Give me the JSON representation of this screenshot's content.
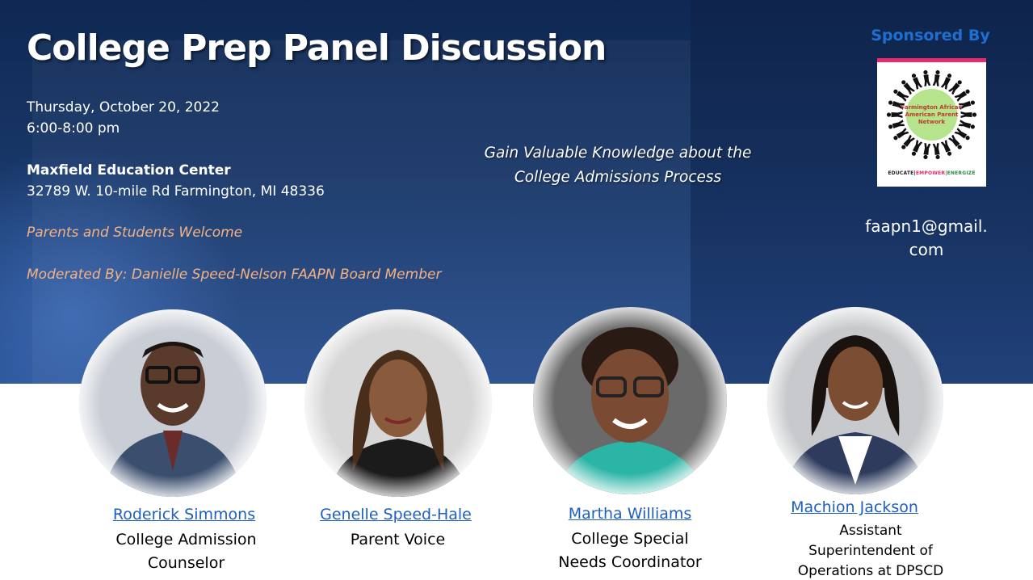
{
  "event": {
    "title": "College Prep Panel Discussion",
    "date": "Thursday, October 20, 2022",
    "time": "6:00-8:00 pm",
    "venue": "Maxfield Education Center",
    "address": "32789 W.  10-mile Rd Farmington, MI 48336",
    "welcome": "Parents and Students Welcome",
    "moderator": "Moderated By:  Danielle Speed-Nelson FAAPN Board Member",
    "tagline_line1": "Gain Valuable Knowledge about the",
    "tagline_line2": "College Admissions Process"
  },
  "sponsor": {
    "label": "Sponsored By",
    "logo_text": "Farmington African American Parent Network",
    "logo_tagline_1": "EDUCATE|",
    "logo_tagline_2": "EMPOWER",
    "logo_tagline_3": "|ENERGIZE",
    "email_line1": "faapn1@gmail.",
    "email_line2": "com"
  },
  "panelists": [
    {
      "name": "Roderick Simmons",
      "role_line1": "College Admission",
      "role_line2": "Counselor"
    },
    {
      "name": "Genelle Speed-Hale",
      "role_line1": "Parent Voice"
    },
    {
      "name": "Martha Williams",
      "role_line1": "College Special",
      "role_line2": "Needs Coordinator"
    },
    {
      "name": "Machion Jackson",
      "role_line1": "Assistant",
      "role_line2": "Superintendent of",
      "role_line3": "Operations at  DPSCD"
    }
  ],
  "colors": {
    "banner_dark": "#0f2853",
    "banner_light": "#284f8f",
    "accent_orange": "#f4b183",
    "link_blue": "#1f5fbf",
    "sponsor_blue": "#1f6fd1",
    "logo_pink": "#e8296b"
  }
}
